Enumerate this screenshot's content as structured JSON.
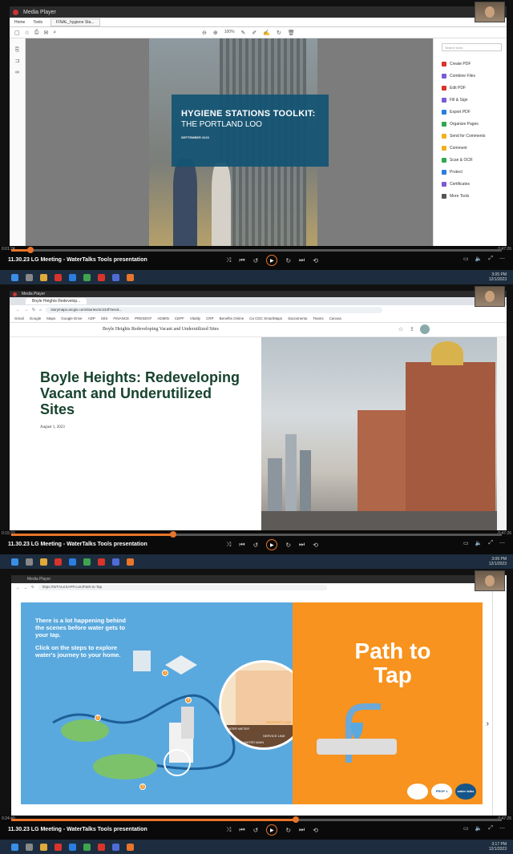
{
  "panels": [
    {
      "app_title": "Media Player",
      "pdf_tabs": [
        "Home",
        "Tools",
        "FINAL_hygiene Sta..."
      ],
      "zoom": "100%",
      "cover_title": "HYGIENE STATIONS TOOLKIT:",
      "cover_subtitle": "THE PORTLAND LOO",
      "cover_date": "SEPTEMBER 2023",
      "tools_search_placeholder": "Search tools",
      "tools": [
        {
          "label": "Create PDF",
          "color": "#d9342b"
        },
        {
          "label": "Combine Files",
          "color": "#7b5bd6"
        },
        {
          "label": "Edit PDF",
          "color": "#d9342b"
        },
        {
          "label": "Fill & Sign",
          "color": "#7b5bd6"
        },
        {
          "label": "Export PDF",
          "color": "#2a7de1"
        },
        {
          "label": "Organize Pages",
          "color": "#2fa84f"
        },
        {
          "label": "Send for Comments",
          "color": "#f2b01e"
        },
        {
          "label": "Comment",
          "color": "#f2b01e"
        },
        {
          "label": "Scan & OCR",
          "color": "#2fa84f"
        },
        {
          "label": "Protect",
          "color": "#2a7de1"
        },
        {
          "label": "Certificates",
          "color": "#7b5bd6"
        },
        {
          "label": "More Tools",
          "color": "#555555"
        }
      ],
      "time_current": "0:01:24",
      "time_total": "0:47:26",
      "progress": 0.04,
      "video_title": "11.30.23 LG Meeting - WaterTalks Tools presentation",
      "clock_time": "3:05 PM",
      "clock_date": "12/1/2023"
    },
    {
      "app_title": "Media Player",
      "browser_tab": "Boyle Heights Redevelop...",
      "url": "storymaps.arcgis.com/stories/4c234f7eec5...",
      "bookmarks": [
        "Gmail",
        "Google",
        "Maps",
        "Google Drive",
        "ADP",
        "SIIS",
        "FINANCE",
        "PRESENT",
        "ADMIN",
        "CEPF",
        "Vitality",
        "CRP",
        "Benefits Online",
        "Ca CDC SmartMaps",
        "Sacramento",
        "Teams",
        "Canvas"
      ],
      "storymap_bar_title": "Boyle Heights Redeveloping Vacant and Underutilized Sites",
      "headline": "Boyle Heights: Redeveloping Vacant and Underutilized Sites",
      "date": "August 1, 2023",
      "time_current": "0:15:33",
      "time_total": "0:47:26",
      "progress": 0.33,
      "video_title": "11.30.23 LG Meeting - WaterTalks Tools presentation",
      "clock_time": "3:06 PM",
      "clock_date": "12/1/2023"
    },
    {
      "app_title": "Media Player",
      "url": "https://WTALKSAPP.com/Path-to-Tap",
      "intro_1": "There is a lot happening behind the scenes before water gets to your tap.",
      "intro_2": "Click on the steps to explore water's journey to your home.",
      "slide_title": "Path to Tap",
      "labels": [
        "WATER METER",
        "SERVICE LINE",
        "WATER MAIN",
        "PROPERTY LINE"
      ],
      "logos": [
        "PROP 1",
        "water talks"
      ],
      "time_current": "0:24:49",
      "time_total": "0:47:26",
      "progress": 0.58,
      "video_title": "11.30.23 LG Meeting - WaterTalks Tools presentation",
      "clock_time": "3:17 PM",
      "clock_date": "12/1/2023"
    }
  ],
  "colors": {
    "accent": "#e8752a",
    "taskbar": "#1d2d3f",
    "pdf_band": "#125473",
    "storymap_green": "#17432e",
    "blue": "#5aa9de",
    "orange": "#f7931e"
  }
}
